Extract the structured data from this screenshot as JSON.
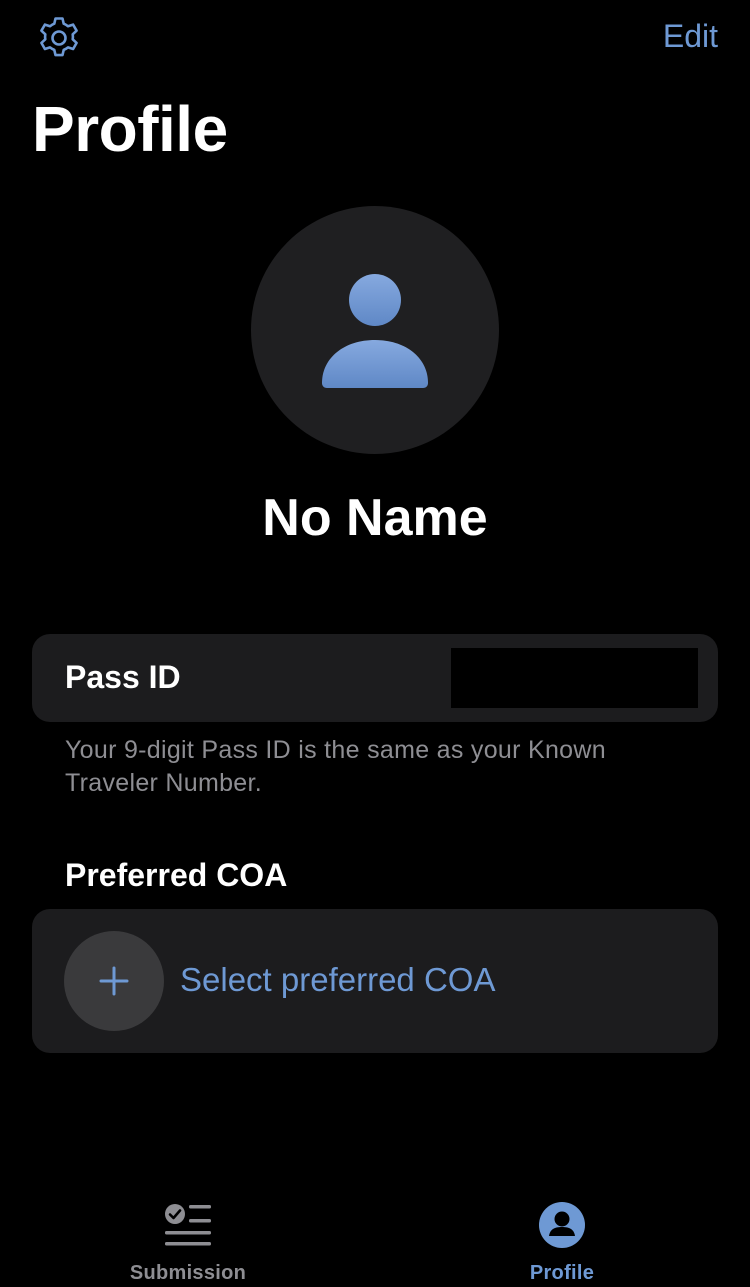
{
  "header": {
    "settings_icon": "gear-icon",
    "edit_label": "Edit",
    "title": "Profile"
  },
  "profile": {
    "avatar_icon": "person-icon",
    "name": "No Name"
  },
  "pass_id": {
    "label": "Pass ID",
    "value": "",
    "help_text": "Your 9-digit Pass ID is the same as your Known Traveler Number."
  },
  "coa": {
    "heading": "Preferred COA",
    "add_icon": "plus-icon",
    "action_label": "Select preferred COA"
  },
  "tab_bar": {
    "tabs": [
      {
        "label": "Submission",
        "icon": "checklist-icon",
        "selected": false
      },
      {
        "label": "Profile",
        "icon": "person-circle-icon",
        "selected": true
      }
    ]
  },
  "colors": {
    "accent": "#6e99d4",
    "background": "#000000",
    "card": "#1c1c1e",
    "secondary_text": "#8e8e93"
  }
}
